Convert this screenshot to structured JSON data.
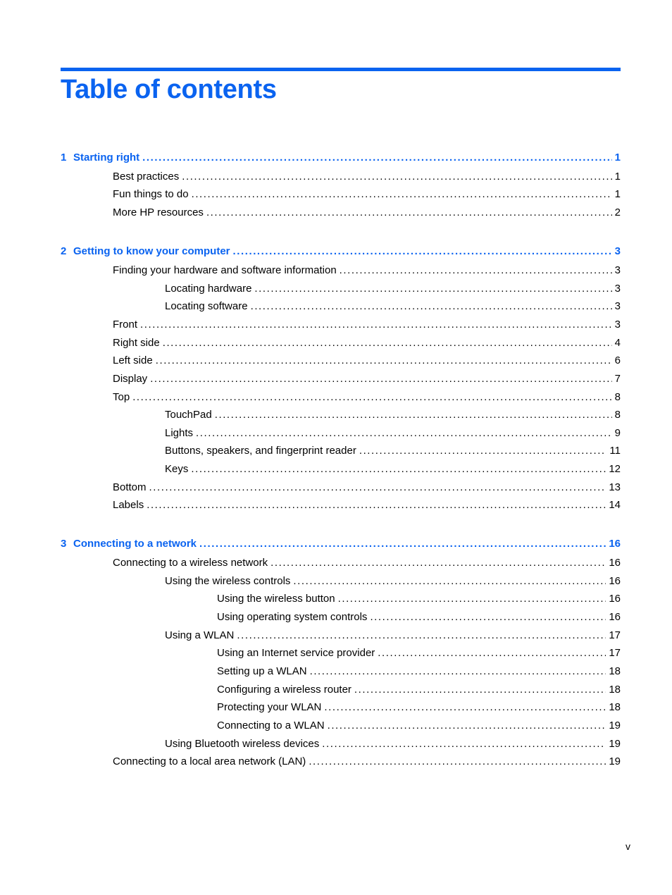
{
  "title": "Table of contents",
  "footer_page": "v",
  "entries": [
    {
      "level": 0,
      "number": "1",
      "label": "Starting right",
      "page": "1"
    },
    {
      "level": 1,
      "label": "Best practices",
      "page": "1"
    },
    {
      "level": 1,
      "label": "Fun things to do",
      "page": "1"
    },
    {
      "level": 1,
      "label": "More HP resources",
      "page": "2"
    },
    {
      "level": 0,
      "number": "2",
      "label": "Getting to know your computer",
      "page": "3"
    },
    {
      "level": 1,
      "label": "Finding your hardware and software information",
      "page": "3"
    },
    {
      "level": 2,
      "label": "Locating hardware",
      "page": "3"
    },
    {
      "level": 2,
      "label": "Locating software",
      "page": "3"
    },
    {
      "level": 1,
      "label": "Front",
      "page": "3"
    },
    {
      "level": 1,
      "label": "Right side",
      "page": "4"
    },
    {
      "level": 1,
      "label": "Left side",
      "page": "6"
    },
    {
      "level": 1,
      "label": "Display",
      "page": "7"
    },
    {
      "level": 1,
      "label": "Top",
      "page": "8"
    },
    {
      "level": 2,
      "label": "TouchPad",
      "page": "8"
    },
    {
      "level": 2,
      "label": "Lights",
      "page": "9"
    },
    {
      "level": 2,
      "label": "Buttons, speakers, and fingerprint reader",
      "page": "11"
    },
    {
      "level": 2,
      "label": "Keys",
      "page": "12"
    },
    {
      "level": 1,
      "label": "Bottom",
      "page": "13"
    },
    {
      "level": 1,
      "label": "Labels",
      "page": "14"
    },
    {
      "level": 0,
      "number": "3",
      "label": "Connecting to a network",
      "page": "16"
    },
    {
      "level": 1,
      "label": "Connecting to a wireless network",
      "page": "16"
    },
    {
      "level": 2,
      "label": "Using the wireless controls",
      "page": "16"
    },
    {
      "level": 3,
      "label": "Using the wireless button",
      "page": "16"
    },
    {
      "level": 3,
      "label": "Using operating system controls",
      "page": "16"
    },
    {
      "level": 2,
      "label": "Using a WLAN",
      "page": "17"
    },
    {
      "level": 3,
      "label": "Using an Internet service provider",
      "page": "17"
    },
    {
      "level": 3,
      "label": "Setting up a WLAN",
      "page": "18"
    },
    {
      "level": 3,
      "label": "Configuring a wireless router",
      "page": "18"
    },
    {
      "level": 3,
      "label": "Protecting your WLAN",
      "page": "18"
    },
    {
      "level": 3,
      "label": "Connecting to a WLAN",
      "page": "19"
    },
    {
      "level": 2,
      "label": "Using Bluetooth wireless devices",
      "page": "19"
    },
    {
      "level": 1,
      "label": "Connecting to a local area network (LAN)",
      "page": "19"
    }
  ]
}
